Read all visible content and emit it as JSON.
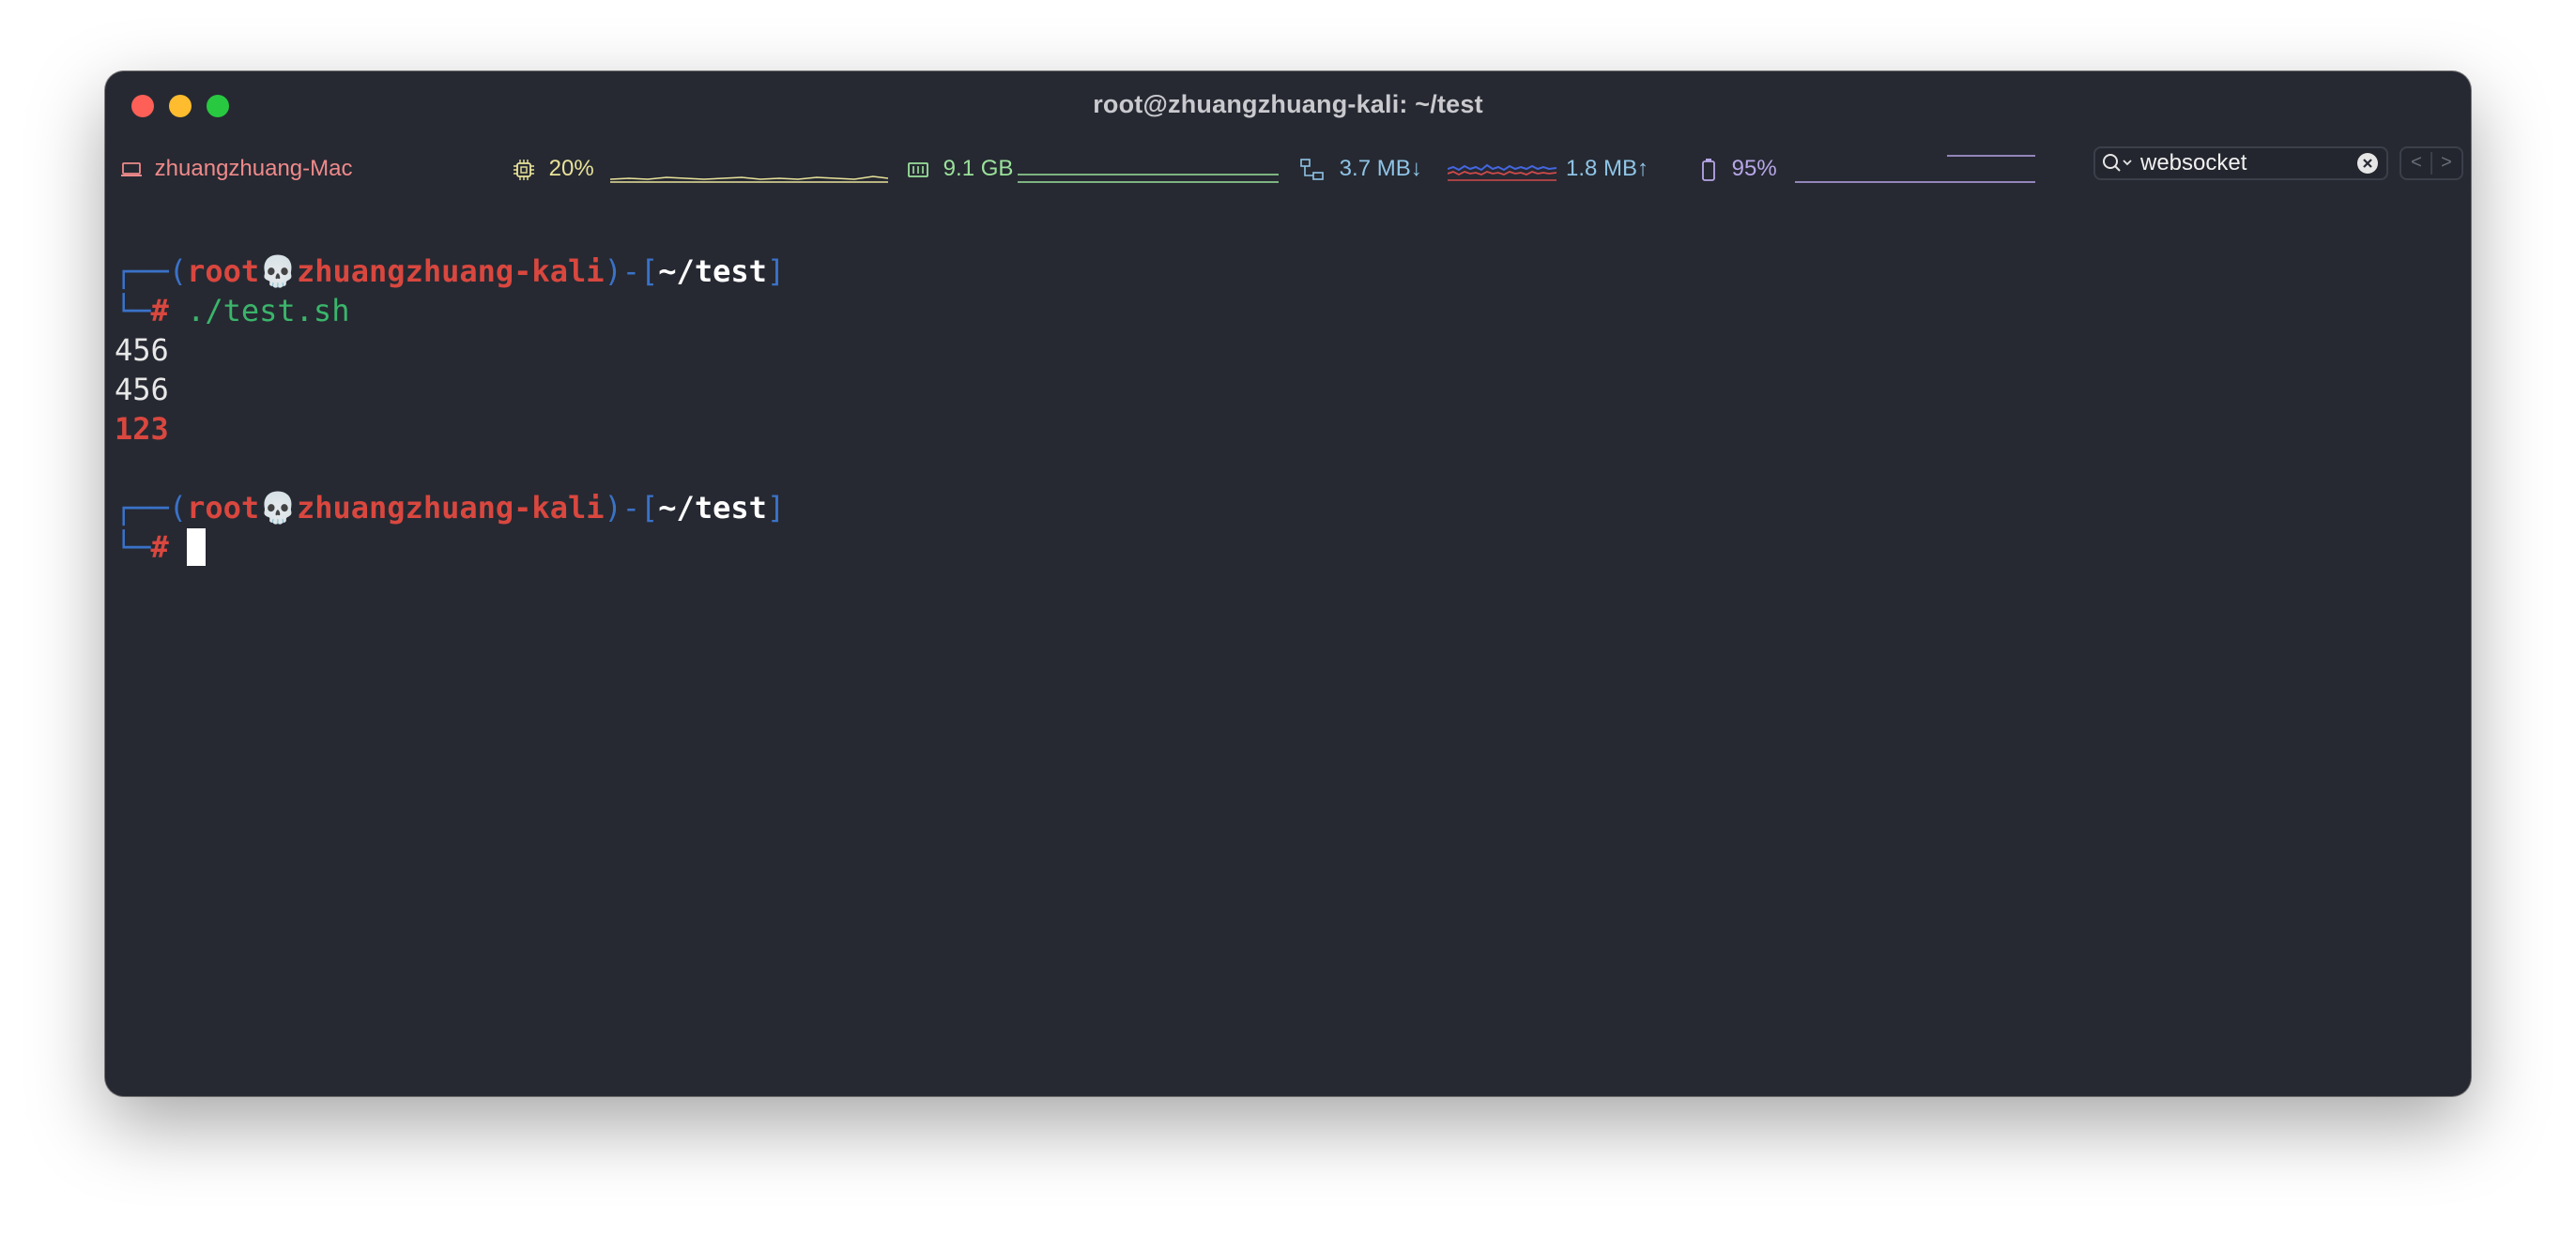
{
  "window": {
    "title": "root@zhuangzhuang-kali: ~/test"
  },
  "statusbar": {
    "host": {
      "icon": "laptop-icon",
      "label": "zhuangzhuang-Mac",
      "color": "#f08a8a"
    },
    "cpu": {
      "icon": "cpu-chip-icon",
      "label": "20%",
      "color": "#e9e39a"
    },
    "memory": {
      "icon": "memory-icon",
      "label": "9.1 GB",
      "color": "#9be29b"
    },
    "network": {
      "icon": "network-icon",
      "down_label": "3.7 MB↓",
      "up_label": "1.8 MB↑",
      "color": "#8fc4e6"
    },
    "battery": {
      "icon": "battery-icon",
      "label": "95%",
      "color": "#b7a6e8"
    }
  },
  "search": {
    "icon": "search-icon",
    "value": "websocket",
    "clear_icon": "clear-circle-icon"
  },
  "nav": {
    "prev_label": "<",
    "next_label": ">"
  },
  "terminal": {
    "prompt1": {
      "user": "root",
      "separator_glyph": "💀",
      "host": "zhuangzhuang-kali",
      "path": "~/test",
      "symbol": "#",
      "command": "./test.sh"
    },
    "output": [
      "456",
      "456",
      "123"
    ],
    "prompt2": {
      "user": "root",
      "separator_glyph": "💀",
      "host": "zhuangzhuang-kali",
      "path": "~/test",
      "symbol": "#"
    }
  },
  "colors": {
    "background": "#262932",
    "prompt_frame": "#3a72c8",
    "prompt_host": "#d9473f",
    "command": "#3bb56b",
    "error_output": "#d9473f"
  }
}
